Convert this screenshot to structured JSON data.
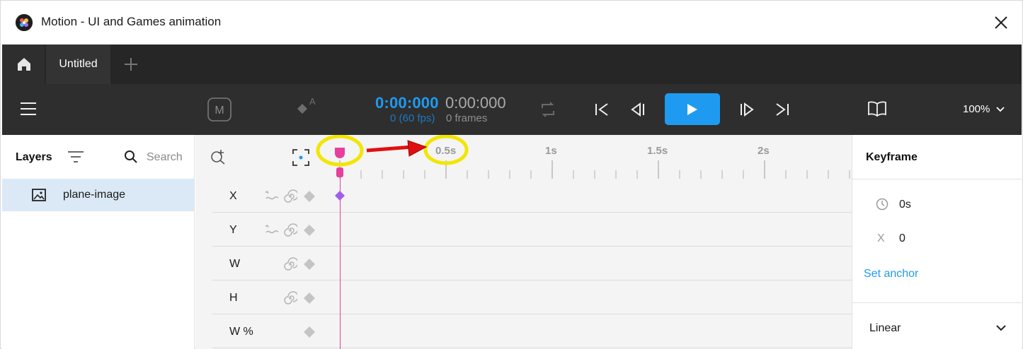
{
  "window": {
    "title": "Motion - UI and Games animation",
    "app_icon": "motion-logo-icon",
    "close_icon": "close-icon"
  },
  "tabs": {
    "home_icon": "home-icon",
    "items": [
      {
        "label": "Untitled",
        "active": true
      }
    ],
    "add_icon": "plus-icon"
  },
  "toolbar": {
    "menu_icon": "hamburger-menu-icon",
    "m_button": "M",
    "auto_key_label": "A",
    "time": "0:00:000",
    "time_sub": "0 (60 fps)",
    "frames_time": "0:00:000",
    "frames_sub": "0 frames",
    "zoom": "100%",
    "accent": "#1e9bf0"
  },
  "layers": {
    "title": "Layers",
    "search_placeholder": "Search",
    "items": [
      {
        "name": "plane-image",
        "selected": true
      }
    ]
  },
  "timeline": {
    "ruler_labels": [
      "0.5s",
      "1s",
      "1.5s",
      "2s"
    ],
    "properties": [
      "X",
      "Y",
      "W",
      "H",
      "W %"
    ],
    "playhead_color": "#e83e9c",
    "keyframe_color": "#a05ee8"
  },
  "annotations": {
    "highlight_color": "#f2e600",
    "arrow_color": "#e01010"
  },
  "keyframe_panel": {
    "title": "Keyframe",
    "time_value": "0s",
    "x_label": "X",
    "x_value": "0",
    "set_anchor": "Set anchor",
    "easing": "Linear"
  }
}
